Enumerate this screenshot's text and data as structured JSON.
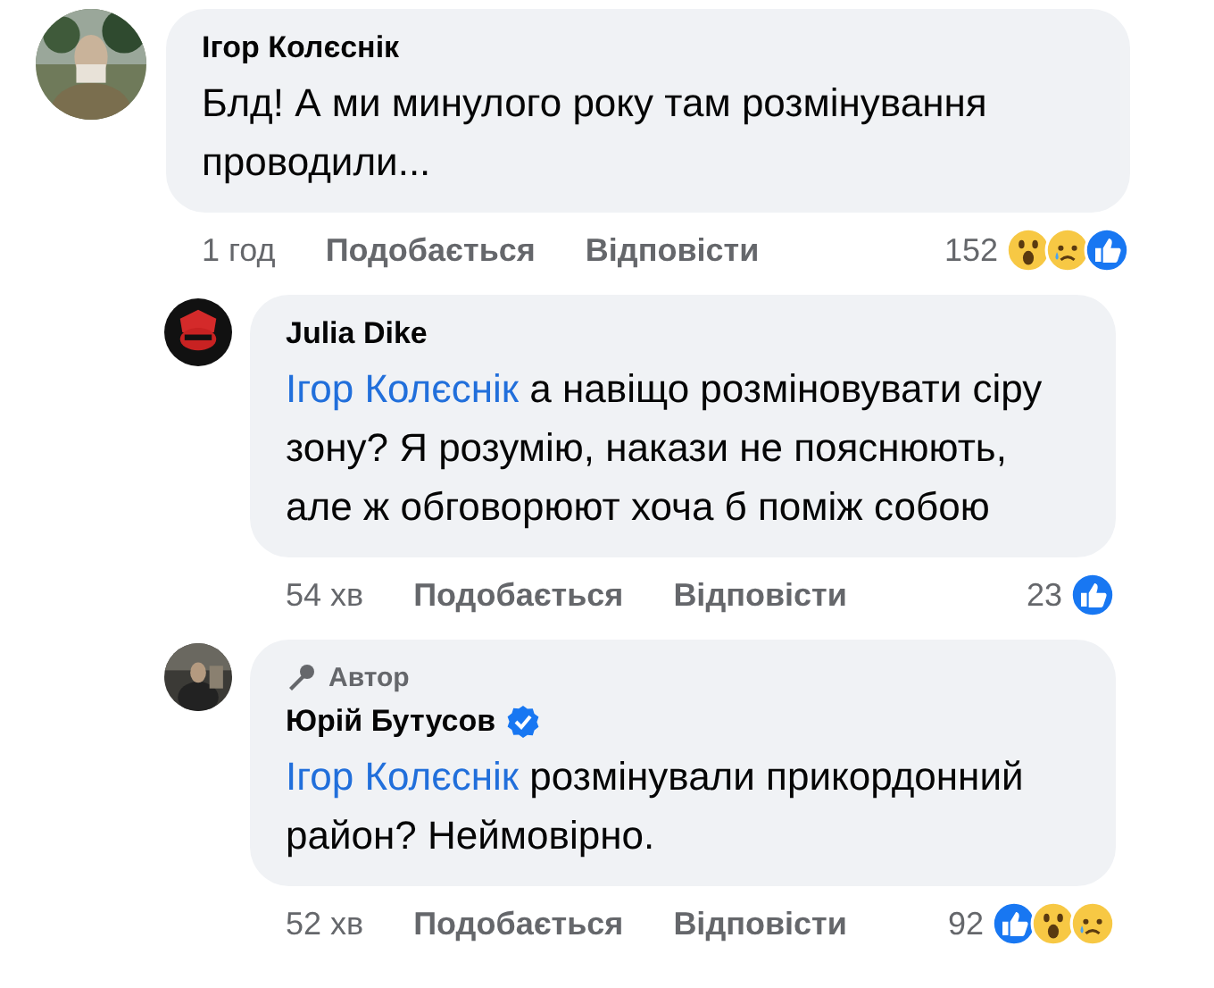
{
  "comments": [
    {
      "author": "Ігор Колєснік",
      "verified": false,
      "text": "Блд! А ми минулого року там розмінування проводили...",
      "time": "1 год",
      "like_label": "Подобається",
      "reply_label": "Відповісти",
      "reaction_count": "152",
      "reactions": [
        {
          "kind": "wow"
        },
        {
          "kind": "sad"
        },
        {
          "kind": "like"
        }
      ],
      "children": [
        {
          "author": "Julia Dike",
          "verified": false,
          "mention": "Ігор Колєснік",
          "text": "а навіщо розміновувати сіру зону? Я розумію, накази не пояснюють, але ж обговорюют хоча б поміж собою",
          "time": "54 хв",
          "like_label": "Подобається",
          "reply_label": "Відповісти",
          "reaction_count": "23",
          "reactions": [
            {
              "kind": "like"
            }
          ]
        },
        {
          "author": "Юрій Бутусов",
          "verified": true,
          "author_badge": "Автор",
          "mention": "Ігор Колєснік",
          "text": "розмінували прикордонний район? Неймовірно.",
          "time": "52 хв",
          "like_label": "Подобається",
          "reply_label": "Відповісти",
          "reaction_count": "92",
          "reactions": [
            {
              "kind": "like"
            },
            {
              "kind": "wow"
            },
            {
              "kind": "sad"
            }
          ]
        }
      ]
    }
  ]
}
